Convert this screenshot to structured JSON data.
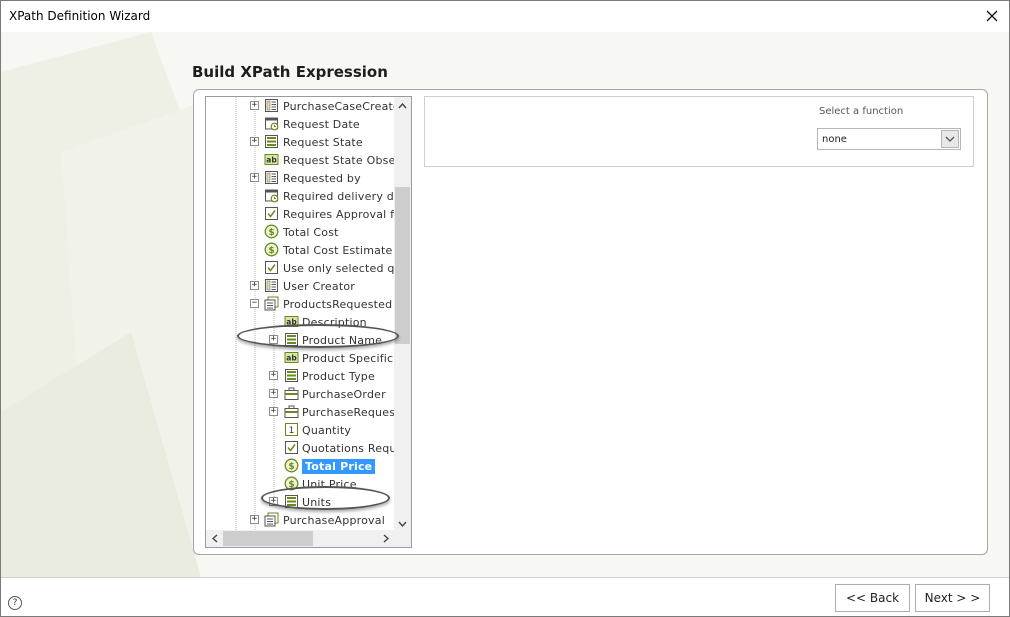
{
  "window": {
    "title": "XPath Definition Wizard"
  },
  "heading": "Build XPath Expression",
  "tree": {
    "nodes": [
      {
        "label": "PurchaseCaseCreato",
        "icon": "entity-icon",
        "expander": "+"
      },
      {
        "label": "Request Date",
        "icon": "date-icon",
        "expander": ""
      },
      {
        "label": "Request State",
        "icon": "list-icon",
        "expander": "+"
      },
      {
        "label": "Request State Obser",
        "icon": "text-icon",
        "expander": ""
      },
      {
        "label": "Requested by",
        "icon": "entity-icon",
        "expander": "+"
      },
      {
        "label": "Required delivery da",
        "icon": "date-icon",
        "expander": ""
      },
      {
        "label": "Requires Approval fo",
        "icon": "checkbox-icon",
        "expander": ""
      },
      {
        "label": "Total Cost",
        "icon": "money-icon",
        "expander": ""
      },
      {
        "label": "Total Cost Estimate",
        "icon": "money-icon",
        "expander": ""
      },
      {
        "label": "Use only selected qu",
        "icon": "checkbox-icon",
        "expander": ""
      },
      {
        "label": "User Creator",
        "icon": "entity-icon",
        "expander": "+"
      },
      {
        "label": "ProductsRequested",
        "icon": "collection-icon",
        "expander": "−"
      },
      {
        "label": "Description",
        "icon": "text-icon",
        "expander": ""
      },
      {
        "label": "Product Name",
        "icon": "list-icon",
        "expander": "+"
      },
      {
        "label": "Product Specifica",
        "icon": "text-icon",
        "expander": ""
      },
      {
        "label": "Product Type",
        "icon": "list-icon",
        "expander": "+"
      },
      {
        "label": "PurchaseOrder",
        "icon": "briefcase-icon",
        "expander": "+"
      },
      {
        "label": "PurchaseRequest",
        "icon": "briefcase-icon",
        "expander": "+"
      },
      {
        "label": "Quantity",
        "icon": "number-icon",
        "expander": ""
      },
      {
        "label": "Quotations Requ",
        "icon": "checkbox-icon",
        "expander": ""
      },
      {
        "label": "Total Price",
        "icon": "money-icon",
        "expander": "",
        "selected": true
      },
      {
        "label": "Unit Price",
        "icon": "money-icon",
        "expander": ""
      },
      {
        "label": "Units",
        "icon": "list-icon",
        "expander": "+"
      },
      {
        "label": "PurchaseApproval",
        "icon": "collection-icon",
        "expander": "+"
      }
    ]
  },
  "function_panel": {
    "label": "Select a function",
    "selected_value": "none"
  },
  "footer": {
    "help_glyph": "?",
    "back_label": "<< Back",
    "next_label": "Next > >"
  },
  "colors": {
    "selection": "#3399ff",
    "icon_green": "#6a8a1e",
    "background": "#f7f7f4"
  }
}
